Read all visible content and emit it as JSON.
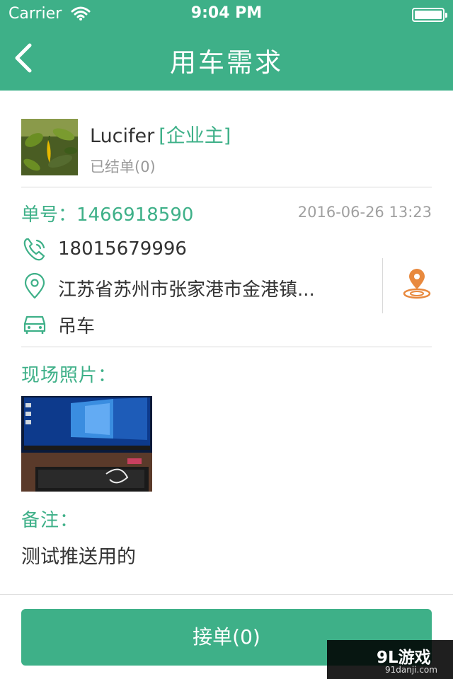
{
  "status_bar": {
    "carrier": "Carrier",
    "time": "9:04 PM"
  },
  "nav": {
    "title": "用车需求"
  },
  "user": {
    "name": "Lucifer",
    "role": "[企业主]",
    "orders_done": "已结单(0)"
  },
  "order": {
    "number": "单号：1466918590",
    "datetime": "2016-06-26 13:23",
    "phone": "18015679996",
    "address": "江苏省苏州市张家港市金港镇...",
    "vehicle": "吊车"
  },
  "photos": {
    "label": "现场照片："
  },
  "remark": {
    "label": "备注：",
    "text": "测试推送用的"
  },
  "action": {
    "accept_label": "接单(0)"
  },
  "watermark": {
    "main": "9L游戏",
    "sub": "91danji.com"
  },
  "colors": {
    "brand": "#3eb088",
    "map_pin": "#e8893e"
  },
  "icons": [
    "chevron-left-icon",
    "wifi-icon",
    "battery-icon",
    "phone-icon",
    "location-pin-icon",
    "car-icon",
    "map-location-icon"
  ]
}
